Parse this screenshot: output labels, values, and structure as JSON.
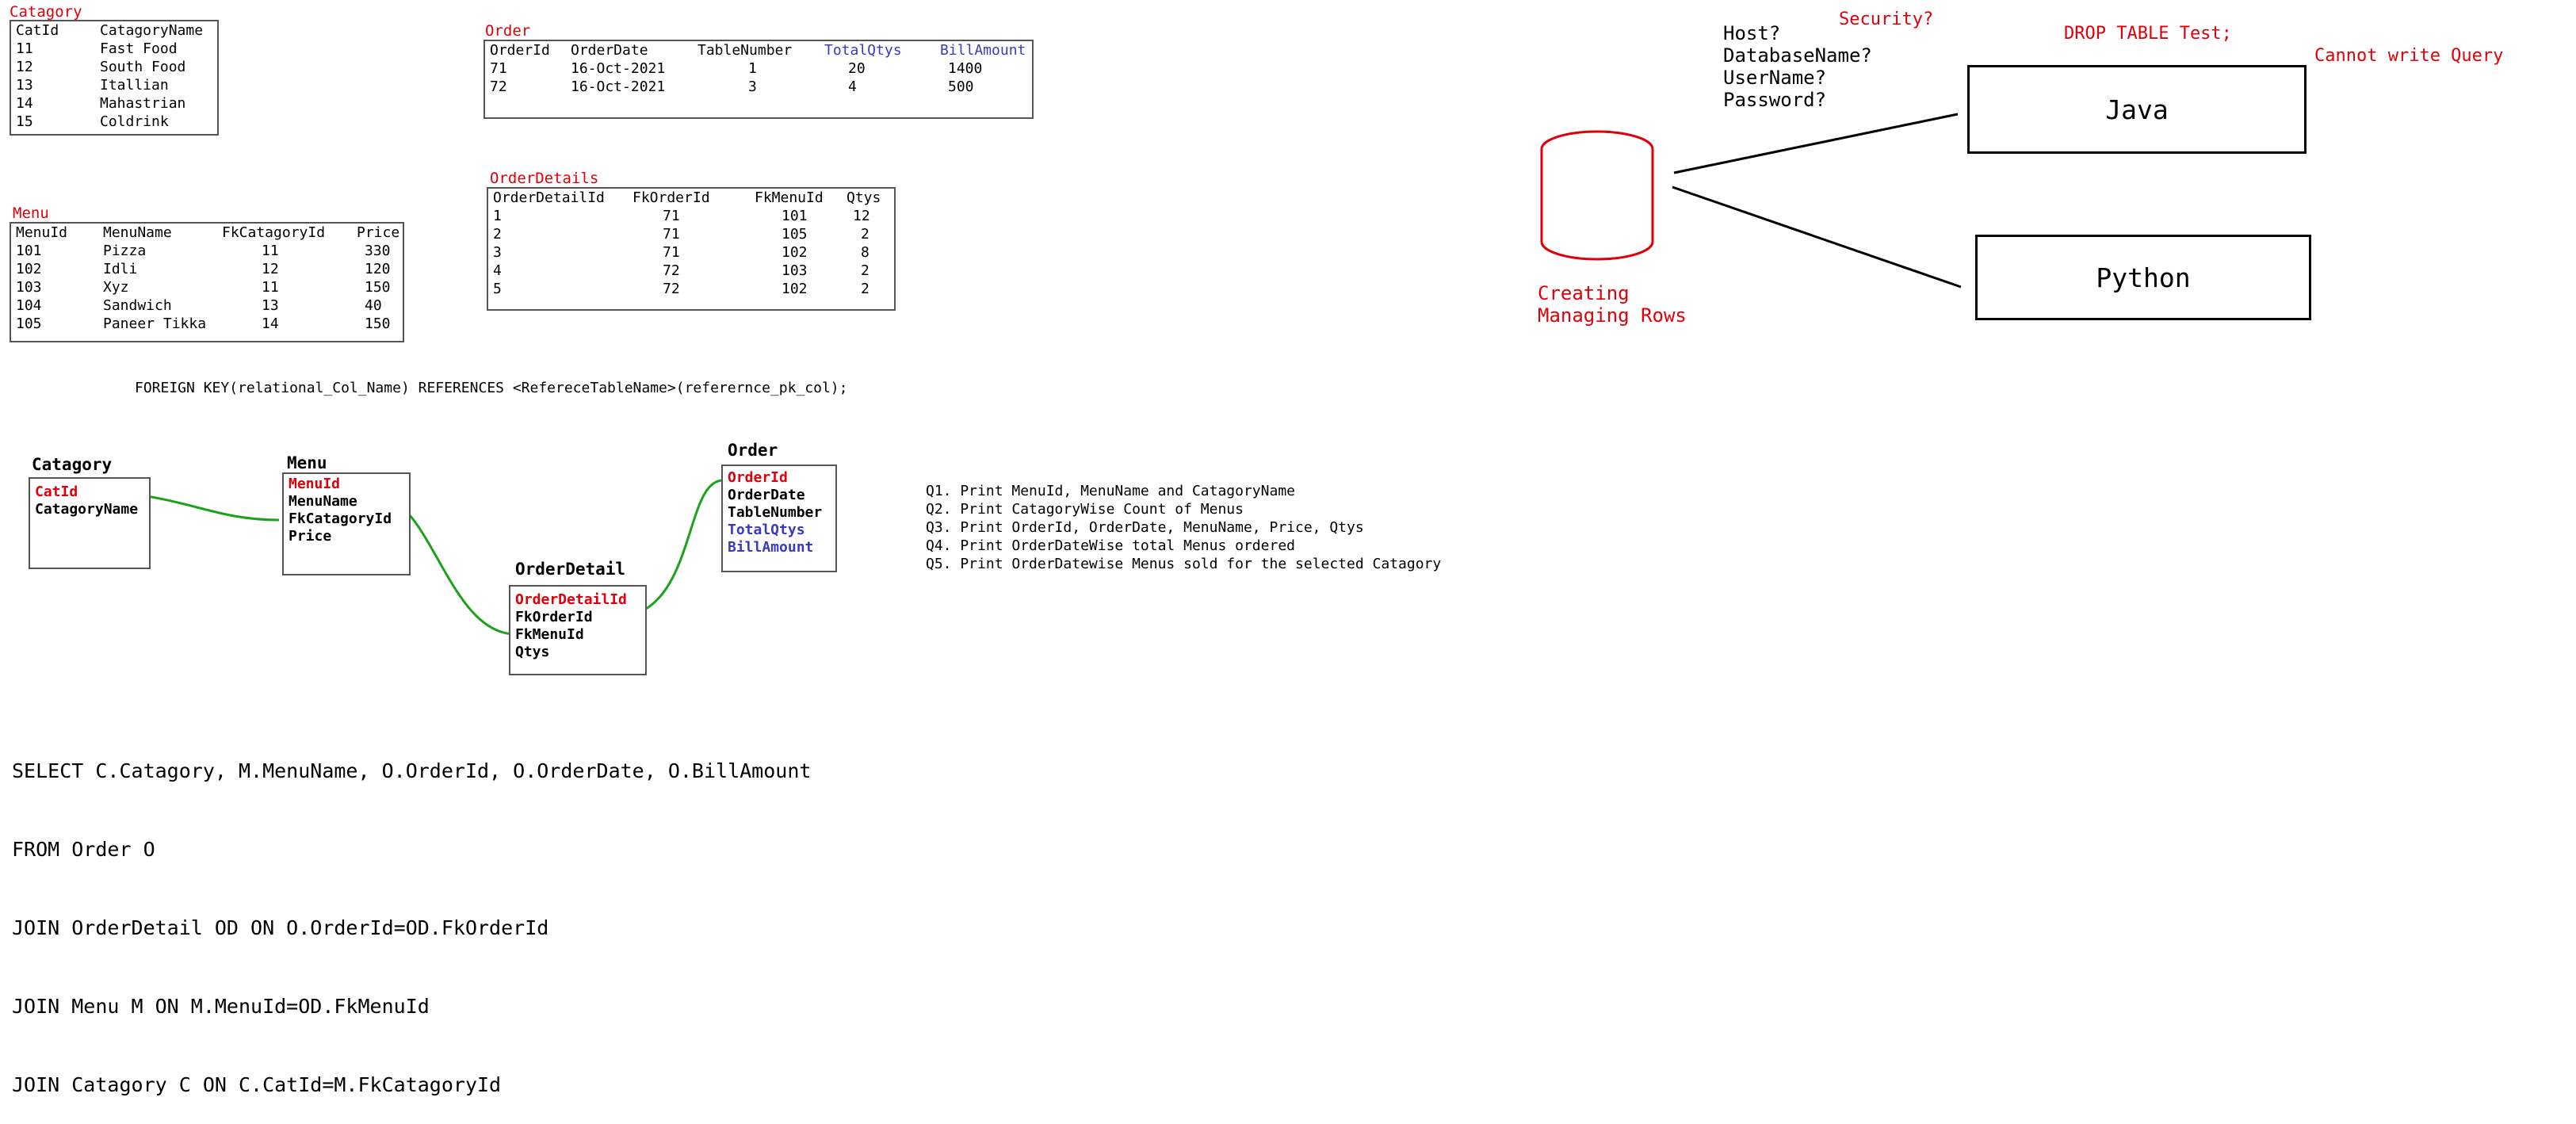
{
  "catagory_table": {
    "title": "Catagory",
    "headers": [
      "CatId",
      "CatagoryName"
    ],
    "rows": [
      [
        "11",
        "Fast Food"
      ],
      [
        "12",
        "South Food"
      ],
      [
        "13",
        "Itallian"
      ],
      [
        "14",
        "Mahastrian"
      ],
      [
        "15",
        "Coldrink"
      ]
    ]
  },
  "order_table": {
    "title": "Order",
    "headers": [
      "OrderId",
      "OrderDate",
      "TableNumber",
      "TotalQtys",
      "BillAmount"
    ],
    "rows": [
      [
        "71",
        "16-Oct-2021",
        "1",
        "20",
        "1400"
      ],
      [
        "72",
        "16-Oct-2021",
        "3",
        "4",
        "500"
      ]
    ]
  },
  "menu_table": {
    "title": "Menu",
    "headers": [
      "MenuId",
      "MenuName",
      "FkCatagoryId",
      "Price"
    ],
    "rows": [
      [
        "101",
        "Pizza",
        "11",
        "330"
      ],
      [
        "102",
        "Idli",
        "12",
        "120"
      ],
      [
        "103",
        "Xyz",
        "11",
        "150"
      ],
      [
        "104",
        "Sandwich",
        "13",
        "40"
      ],
      [
        "105",
        "Paneer Tikka",
        "14",
        "150"
      ]
    ]
  },
  "orderdetails_table": {
    "title": "OrderDetails",
    "headers": [
      "OrderDetailId",
      "FkOrderId",
      "FkMenuId",
      "Qtys"
    ],
    "rows": [
      [
        "1",
        "71",
        "101",
        "12"
      ],
      [
        "2",
        "71",
        "105",
        "2"
      ],
      [
        "3",
        "71",
        "102",
        "8"
      ],
      [
        "4",
        "72",
        "103",
        "2"
      ],
      [
        "5",
        "72",
        "102",
        "2"
      ]
    ]
  },
  "fk_syntax": "FOREIGN KEY(relational_Col_Name) REFERENCES <RefereceTableName>(referernce_pk_col);",
  "er": {
    "catagory": {
      "title": "Catagory",
      "pk": "CatId",
      "fields": [
        "CatagoryName"
      ]
    },
    "menu": {
      "title": "Menu",
      "pk": "MenuId",
      "fields": [
        "MenuName",
        "FkCatagoryId",
        "Price"
      ]
    },
    "orderdetail": {
      "title": "OrderDetail",
      "pk": "OrderDetailId",
      "fields": [
        "FkOrderId",
        "FkMenuId",
        "Qtys"
      ]
    },
    "order": {
      "title": "Order",
      "pk": "OrderId",
      "fields": [
        "OrderDate",
        "TableNumber"
      ],
      "blue_fields": [
        "TotalQtys",
        "BillAmount"
      ]
    }
  },
  "questions": [
    "Q1. Print MenuId, MenuName and CatagoryName",
    "Q2. Print CatagoryWise Count of Menus",
    "Q3. Print OrderId, OrderDate, MenuName, Price, Qtys",
    "Q4. Print OrderDateWise total Menus ordered",
    "Q5. Print OrderDatewise Menus sold for the selected Catagory"
  ],
  "sql_lines": [
    "SELECT C.Catagory, M.MenuName, O.OrderId, O.OrderDate, O.BillAmount",
    "FROM Order O",
    "JOIN OrderDetail OD ON O.OrderId=OD.FkOrderId",
    "JOIN Menu M ON M.MenuId=OD.FkMenuId",
    "JOIN Catagory C ON C.CatId=M.FkCatagoryId"
  ],
  "db_diagram": {
    "caption_line1": "Creating",
    "caption_line2": "Managing Rows",
    "connection_params": [
      "Host?",
      "DatabaseName?",
      "UserName?",
      "Password?"
    ],
    "security": "Security?",
    "drop_table": "DROP TABLE Test;",
    "cannot_write": "Cannot write Query",
    "java": "Java",
    "python": "Python"
  },
  "colors": {
    "pk": "#e0000a",
    "link": "#1aa31a",
    "blue": "#3a3ac0"
  }
}
